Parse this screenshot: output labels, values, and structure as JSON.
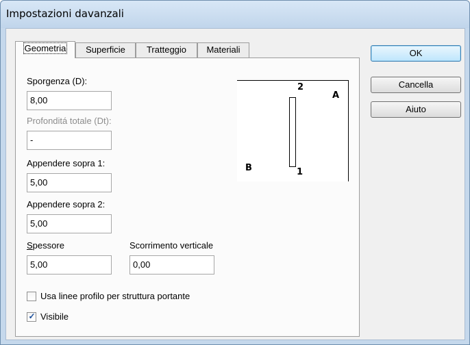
{
  "window": {
    "title": "Impostazioni davanzali"
  },
  "tabs": [
    {
      "label": "Geometria",
      "active": true
    },
    {
      "label": "Superficie",
      "active": false
    },
    {
      "label": "Tratteggio",
      "active": false
    },
    {
      "label": "Materiali",
      "active": false
    }
  ],
  "form": {
    "sporgenza_label": "Sporgenza (D):",
    "sporgenza_value": "8,00",
    "profondita_label": "Profonditá totale (Dt):",
    "profondita_value": "-",
    "appendere1_label": "Appendere sopra 1:",
    "appendere1_value": "5,00",
    "appendere2_label": "Appendere sopra 2:",
    "appendere2_value": "5,00",
    "spessore_label_first": "S",
    "spessore_label_rest": "pessore",
    "spessore_value": "5,00",
    "scorrimento_label": "Scorrimento verticale",
    "scorrimento_value": "0,00",
    "usa_linee_label": "Usa linee profilo per struttura portante",
    "usa_linee_checked": false,
    "visibile_label": "Visibile",
    "visibile_checked": true
  },
  "preview": {
    "label_a": "A",
    "label_b": "B",
    "label_top": "2",
    "label_bottom": "1"
  },
  "buttons": {
    "ok": "OK",
    "cancel": "Cancella",
    "help": "Aiuto"
  }
}
